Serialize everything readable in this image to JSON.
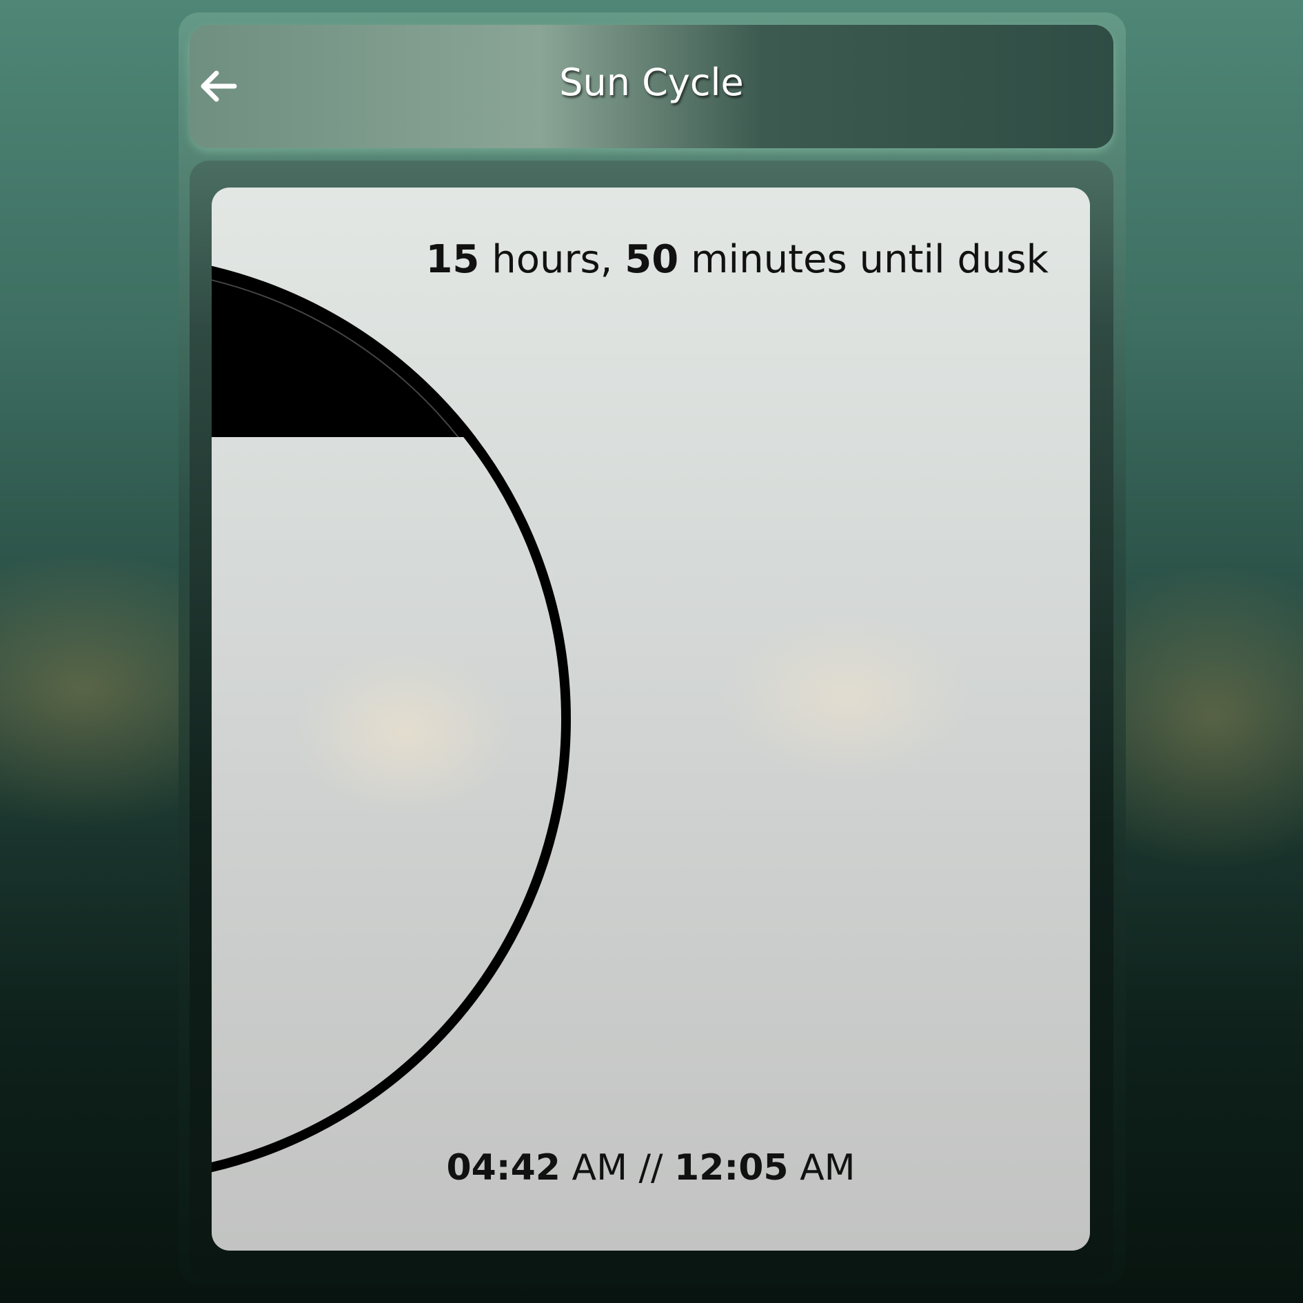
{
  "header": {
    "title": "Sun Cycle",
    "back_icon": "arrow-left-icon"
  },
  "countdown": {
    "hours": "15",
    "hours_label": " hours, ",
    "minutes": "50",
    "minutes_label": " minutes until dusk"
  },
  "times": {
    "sunrise": "04:42",
    "sunrise_period": " AM",
    "separator": " // ",
    "sunset": "12:05",
    "sunset_period": " AM"
  },
  "colors": {
    "accent": "#000000",
    "card": "#d6dad8"
  }
}
